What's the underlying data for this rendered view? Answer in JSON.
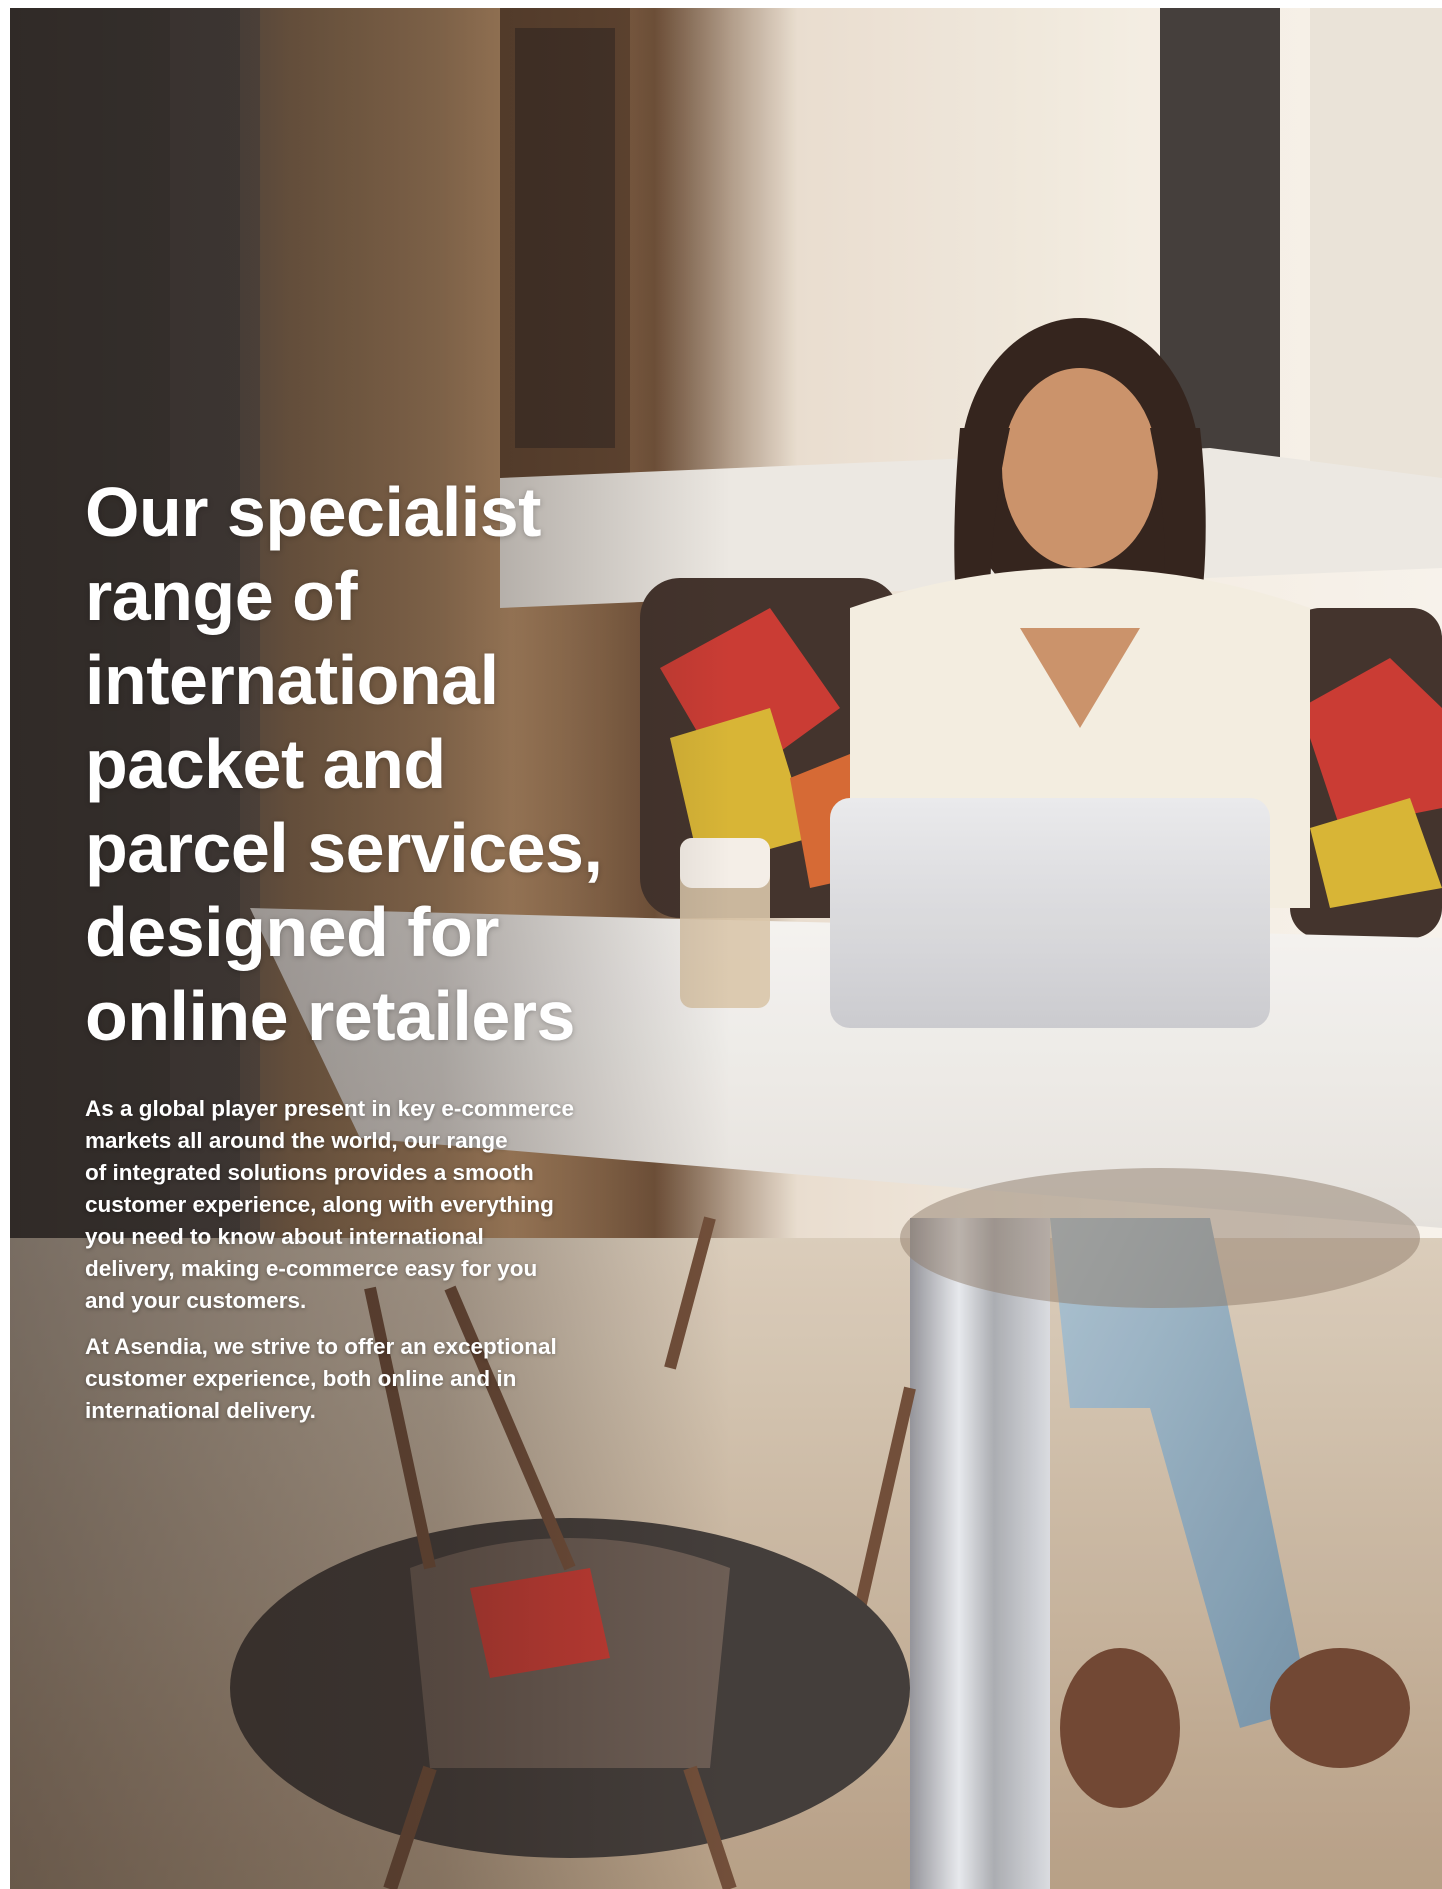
{
  "headline_lines": [
    "Our specialist",
    "range of",
    "international",
    "packet and",
    "parcel services,",
    "designed for",
    "online retailers"
  ],
  "body": {
    "paragraph1_lines": [
      "As a global player present in key e-commerce",
      "markets all around the world, our range",
      "of integrated solutions provides a smooth",
      "customer experience, along with everything",
      "you need to know about international",
      "delivery, making e-commerce easy for you",
      "and your customers."
    ],
    "paragraph2_lines": [
      "At Asendia, we strive to offer an exceptional",
      "customer experience, both online and in",
      "international delivery."
    ]
  },
  "colors": {
    "text": "#ffffff"
  }
}
